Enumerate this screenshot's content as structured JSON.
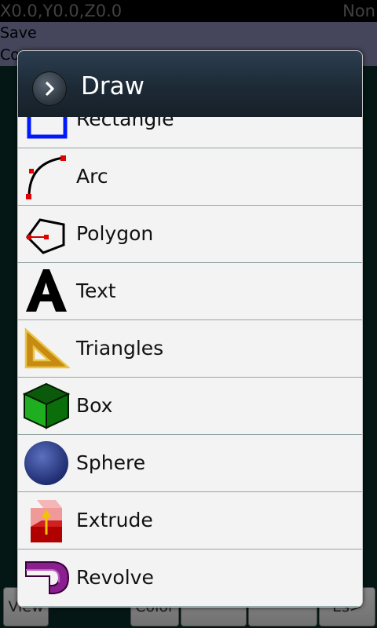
{
  "status": {
    "coords": "X0.0,Y0.0,Z0.0",
    "right_text": "Non"
  },
  "menu": {
    "item1": "Save",
    "item2": "Co"
  },
  "bottom": {
    "b1": "View",
    "b2": "Color",
    "b5": "Es>"
  },
  "dialog": {
    "title": "Draw",
    "items": [
      {
        "label": "Rectangle",
        "icon": "rectangle-icon"
      },
      {
        "label": "Arc",
        "icon": "arc-icon"
      },
      {
        "label": "Polygon",
        "icon": "polygon-icon"
      },
      {
        "label": "Text",
        "icon": "text-icon"
      },
      {
        "label": "Triangles",
        "icon": "triangles-icon"
      },
      {
        "label": "Box",
        "icon": "box-icon"
      },
      {
        "label": "Sphere",
        "icon": "sphere-icon"
      },
      {
        "label": "Extrude",
        "icon": "extrude-icon"
      },
      {
        "label": "Revolve",
        "icon": "revolve-icon"
      }
    ]
  }
}
